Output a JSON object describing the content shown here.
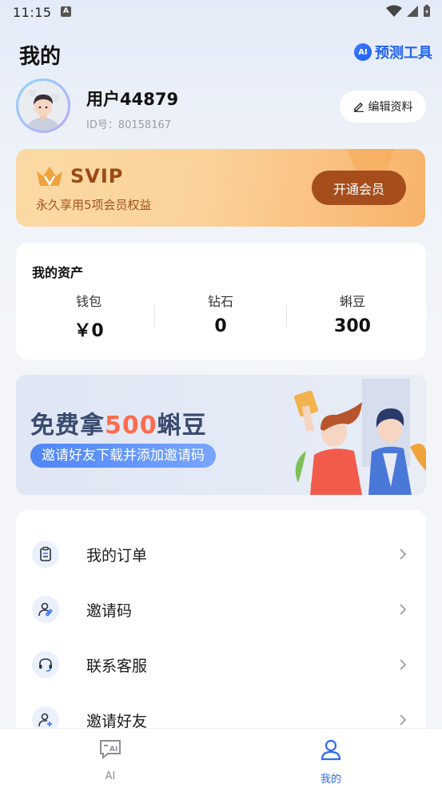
{
  "status_bar": {
    "time": "11:15",
    "notification_icon": "A"
  },
  "header": {
    "title": "我的",
    "tool_badge": "AI",
    "tool_label": "预测工具"
  },
  "profile": {
    "username": "用户44879",
    "user_id": "ID号：80158167",
    "edit_label": "编辑资料"
  },
  "svip": {
    "title": "SVIP",
    "subtitle": "永久享用5项会员权益",
    "button_label": "开通会员"
  },
  "assets": {
    "title": "我的资产",
    "items": [
      {
        "label": "钱包",
        "value": "￥0"
      },
      {
        "label": "钻石",
        "value": "0"
      },
      {
        "label": "蝌豆",
        "value": "300"
      }
    ]
  },
  "invite_banner": {
    "title_prefix": "免费拿",
    "title_highlight": "500",
    "title_suffix": "蝌豆",
    "subtitle": "邀请好友下载并添加邀请码"
  },
  "menu": {
    "items": [
      {
        "label": "我的订单",
        "icon": "clipboard-icon"
      },
      {
        "label": "邀请码",
        "icon": "user-link-icon"
      },
      {
        "label": "联系客服",
        "icon": "headset-icon"
      },
      {
        "label": "邀请好友",
        "icon": "user-add-icon"
      }
    ]
  },
  "bottom_nav": {
    "items": [
      {
        "label": "AI",
        "icon": "ai-chat-icon",
        "active": false
      },
      {
        "label": "我的",
        "icon": "user-icon",
        "active": true
      }
    ]
  },
  "colors": {
    "accent": "#2163f0",
    "svip_button": "#a64d1c",
    "nav_active": "#2f6bf2",
    "nav_inactive": "#8a8d93"
  }
}
